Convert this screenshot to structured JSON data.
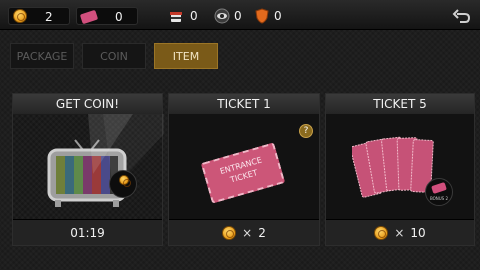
{
  "header": {
    "coins": "2",
    "tickets": "0",
    "stat_cup": "0",
    "stat_eye": "0",
    "stat_shield": "0",
    "icons": [
      "coin-icon",
      "ticket-icon",
      "noodle-cup-icon",
      "eye-icon",
      "shield-icon",
      "back-arrow-icon"
    ]
  },
  "tabs": [
    {
      "label": "PACKAGE",
      "active": false
    },
    {
      "label": "COIN",
      "active": false
    },
    {
      "label": "ITEM",
      "active": true
    }
  ],
  "cards": [
    {
      "title": "GET COIN!",
      "timer": "01:19",
      "icon": "tv-icon"
    },
    {
      "title": "TICKET 1",
      "ticket_text_line1": "ENTRANCE",
      "ticket_text_line2": "TICKET",
      "multiplier": "×",
      "price": "2",
      "icon": "ticket-icon"
    },
    {
      "title": "TICKET 5",
      "multiplier": "×",
      "price": "10",
      "bonus_label": "BONUS 2",
      "icon": "ticket-stack-icon"
    }
  ],
  "colors": {
    "accent": "#7a5a18",
    "ticket": "#d14f7d",
    "coin": "#e89a16",
    "tv_frame": "#b3b3b3"
  }
}
